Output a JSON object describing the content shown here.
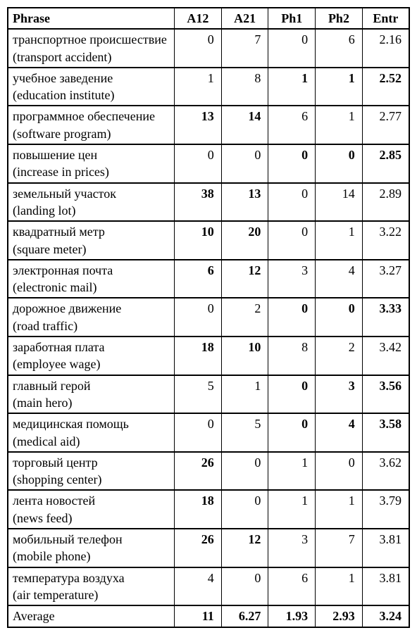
{
  "chart_data": {
    "type": "table",
    "headers": [
      "Phrase",
      "A12",
      "A21",
      "Ph1",
      "Ph2",
      "Entr"
    ],
    "rows": [
      {
        "phrase_ru": "транспортное происшествие",
        "phrase_en": "(transport accident)",
        "a12": "0",
        "a21": "7",
        "ph1": "0",
        "ph2": "6",
        "entr": "2.16",
        "bold": {}
      },
      {
        "phrase_ru": "учебное заведение",
        "phrase_en": "(education institute)",
        "a12": "1",
        "a21": "8",
        "ph1": "1",
        "ph2": "1",
        "entr": "2.52",
        "bold": {
          "ph1": true,
          "ph2": true,
          "entr": true
        }
      },
      {
        "phrase_ru": "программное обеспечение",
        "phrase_en": "(software program)",
        "a12": "13",
        "a21": "14",
        "ph1": "6",
        "ph2": "1",
        "entr": "2.77",
        "bold": {
          "a12": true,
          "a21": true
        }
      },
      {
        "phrase_ru": "повышение цен",
        "phrase_en": "(increase in prices)",
        "a12": "0",
        "a21": "0",
        "ph1": "0",
        "ph2": "0",
        "entr": "2.85",
        "bold": {
          "ph1": true,
          "ph2": true,
          "entr": true
        }
      },
      {
        "phrase_ru": "земельный участок",
        "phrase_en": "(landing lot)",
        "a12": "38",
        "a21": "13",
        "ph1": "0",
        "ph2": "14",
        "entr": "2.89",
        "bold": {
          "a12": true,
          "a21": true
        }
      },
      {
        "phrase_ru": "квадратный метр",
        "phrase_en": "(square meter)",
        "a12": "10",
        "a21": "20",
        "ph1": "0",
        "ph2": "1",
        "entr": "3.22",
        "bold": {
          "a12": true,
          "a21": true
        }
      },
      {
        "phrase_ru": "электронная почта",
        "phrase_en": "(electronic mail)",
        "a12": "6",
        "a21": "12",
        "ph1": "3",
        "ph2": "4",
        "entr": "3.27",
        "bold": {
          "a12": true,
          "a21": true
        }
      },
      {
        "phrase_ru": "дорожное движение",
        "phrase_en": "(road traffic)",
        "a12": "0",
        "a21": "2",
        "ph1": "0",
        "ph2": "0",
        "entr": "3.33",
        "bold": {
          "ph1": true,
          "ph2": true,
          "entr": true
        }
      },
      {
        "phrase_ru": "заработная плата",
        "phrase_en": "(employee wage)",
        "a12": "18",
        "a21": "10",
        "ph1": "8",
        "ph2": "2",
        "entr": "3.42",
        "bold": {
          "a12": true,
          "a21": true
        }
      },
      {
        "phrase_ru": "главный герой",
        "phrase_en": "(main hero)",
        "a12": "5",
        "a21": "1",
        "ph1": "0",
        "ph2": "3",
        "entr": "3.56",
        "bold": {
          "ph1": true,
          "ph2": true,
          "entr": true
        }
      },
      {
        "phrase_ru": "медицинская помощь",
        "phrase_en": "(medical aid)",
        "a12": "0",
        "a21": "5",
        "ph1": "0",
        "ph2": "4",
        "entr": "3.58",
        "bold": {
          "ph1": true,
          "ph2": true,
          "entr": true
        }
      },
      {
        "phrase_ru": "торговый центр",
        "phrase_en": "(shopping center)",
        "a12": "26",
        "a21": "0",
        "ph1": "1",
        "ph2": "0",
        "entr": "3.62",
        "bold": {
          "a12": true
        }
      },
      {
        "phrase_ru": "лента новостей",
        "phrase_en": "(news feed)",
        "a12": "18",
        "a21": "0",
        "ph1": "1",
        "ph2": "1",
        "entr": "3.79",
        "bold": {
          "a12": true
        }
      },
      {
        "phrase_ru": "мобильный телефон",
        "phrase_en": "(mobile phone)",
        "a12": "26",
        "a21": "12",
        "ph1": "3",
        "ph2": "7",
        "entr": "3.81",
        "bold": {
          "a12": true,
          "a21": true
        }
      },
      {
        "phrase_ru": "температура воздуха",
        "phrase_en": "(air temperature)",
        "a12": "4",
        "a21": "0",
        "ph1": "6",
        "ph2": "1",
        "entr": "3.81",
        "bold": {}
      }
    ],
    "footer": {
      "label": "Average",
      "a12": "11",
      "a21": "6.27",
      "ph1": "1.93",
      "ph2": "2.93",
      "entr": "3.24",
      "bold": {
        "a12": true,
        "a21": true,
        "ph1": true,
        "ph2": true,
        "entr": true
      }
    }
  }
}
